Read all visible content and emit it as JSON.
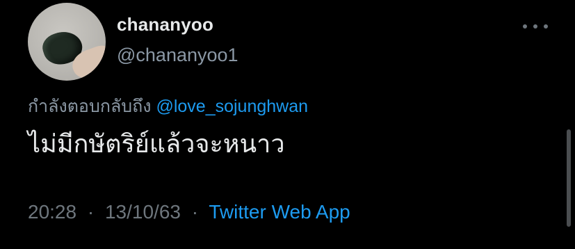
{
  "tweet": {
    "display_name": "chananyoo",
    "handle": "@chananyoo1",
    "reply_prefix": "กำลังตอบกลับถึง",
    "reply_mention": "@love_sojunghwan",
    "text": "ไม่มีกษัตริย์แล้วจะหนาว",
    "time": "20:28",
    "date": "13/10/63",
    "separator": "·",
    "source": "Twitter Web App"
  },
  "icons": {
    "more": "more-horizontal-icon",
    "avatar": "profile-avatar"
  },
  "colors": {
    "background": "#000000",
    "primary_text": "#e7e9ea",
    "secondary_text": "#8b98a5",
    "link": "#1d9bf0"
  }
}
